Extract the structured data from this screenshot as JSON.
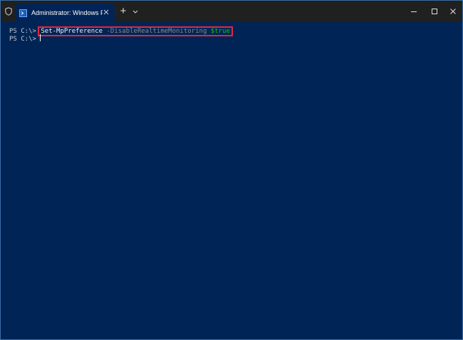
{
  "window": {
    "tab_title": "Administrator: Windows Powe",
    "new_tab_symbol": "+",
    "icons": {
      "shield": "shield-icon",
      "tab": "powershell-icon",
      "close_tab": "close-icon",
      "dropdown": "chevron-down-icon",
      "minimize": "minimize-icon",
      "maximize": "maximize-icon",
      "close_window": "close-icon"
    }
  },
  "terminal": {
    "line1": {
      "prompt": "PS C:\\> ",
      "cmdlet": "Set-MpPreference",
      "parameter": " -DisableRealtimeMonitoring ",
      "value": "$true"
    },
    "line2": {
      "prompt": "PS C:\\> "
    }
  },
  "colors": {
    "terminal_bg": "#012456",
    "titlebar_bg": "#202020",
    "highlight_box": "#e0283c",
    "variable": "#16c60c"
  }
}
